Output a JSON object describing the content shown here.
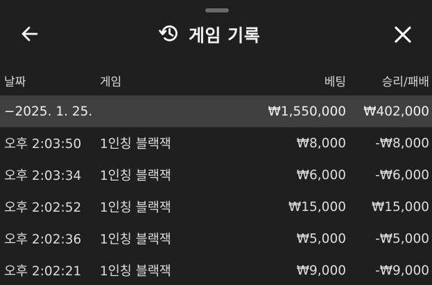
{
  "header": {
    "title": "게임 기록"
  },
  "icons": {
    "back": "arrow-left-icon",
    "history": "history-clock-icon",
    "close": "close-x-icon"
  },
  "columns": {
    "date": "날짜",
    "game": "게임",
    "bet": "베팅",
    "result": "승리/패배"
  },
  "group": {
    "date": "−2025. 1. 25.",
    "bet": "₩1,550,000",
    "result": "₩402,000"
  },
  "rows": [
    {
      "time": "오후 2:03:50",
      "game": "1인칭 블랙잭",
      "bet": "₩8,000",
      "result": "-₩8,000"
    },
    {
      "time": "오후 2:03:34",
      "game": "1인칭 블랙잭",
      "bet": "₩6,000",
      "result": "-₩6,000"
    },
    {
      "time": "오후 2:02:52",
      "game": "1인칭 블랙잭",
      "bet": "₩15,000",
      "result": "₩15,000"
    },
    {
      "time": "오후 2:02:36",
      "game": "1인칭 블랙잭",
      "bet": "₩5,000",
      "result": "-₩5,000"
    },
    {
      "time": "오후 2:02:21",
      "game": "1인칭 블랙잭",
      "bet": "₩9,000",
      "result": "-₩9,000"
    }
  ],
  "colors": {
    "background": "#1f1f1f",
    "group_row": "#3f3f3f",
    "text": "#e6e6e6"
  }
}
